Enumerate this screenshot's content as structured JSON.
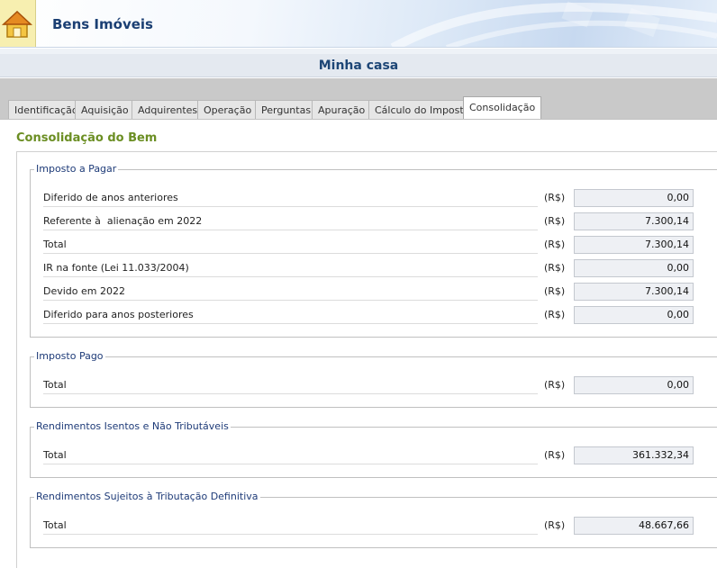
{
  "header": {
    "title": "Bens Imóveis"
  },
  "asset": {
    "name": "Minha casa"
  },
  "tabs": [
    {
      "label": "Identificação"
    },
    {
      "label": "Aquisição"
    },
    {
      "label": "Adquirentes"
    },
    {
      "label": "Operação"
    },
    {
      "label": "Perguntas"
    },
    {
      "label": "Apuração"
    },
    {
      "label": "Cálculo do Imposto"
    },
    {
      "label": "Consolidação",
      "active": true
    }
  ],
  "section_title": "Consolidação do Bem",
  "groups": [
    {
      "legend": "Imposto a Pagar",
      "rows": [
        {
          "label": "Diferido de anos anteriores",
          "currency": "(R$)",
          "value": "0,00"
        },
        {
          "label": "Referente à  alienação em 2022",
          "currency": "(R$)",
          "value": "7.300,14"
        },
        {
          "label": "Total",
          "currency": "(R$)",
          "value": "7.300,14"
        },
        {
          "label": "IR na fonte (Lei 11.033/2004)",
          "currency": "(R$)",
          "value": "0,00"
        },
        {
          "label": "Devido em 2022",
          "currency": "(R$)",
          "value": "7.300,14"
        },
        {
          "label": "Diferido para anos posteriores",
          "currency": "(R$)",
          "value": "0,00"
        }
      ]
    },
    {
      "legend": "Imposto Pago",
      "rows": [
        {
          "label": "Total",
          "currency": "(R$)",
          "value": "0,00"
        }
      ]
    },
    {
      "legend": "Rendimentos Isentos e Não Tributáveis",
      "rows": [
        {
          "label": "Total",
          "currency": "(R$)",
          "value": "361.332,34"
        }
      ]
    },
    {
      "legend": "Rendimentos Sujeitos à Tributação Definitiva",
      "rows": [
        {
          "label": "Total",
          "currency": "(R$)",
          "value": "48.667,66"
        }
      ]
    }
  ],
  "colors": {
    "header_text": "#1b3f73",
    "section_title": "#6b8e23",
    "legend_text": "#1e3b78",
    "tab_bar": "#c9c9c9"
  },
  "icons": {
    "home": "home-icon"
  }
}
